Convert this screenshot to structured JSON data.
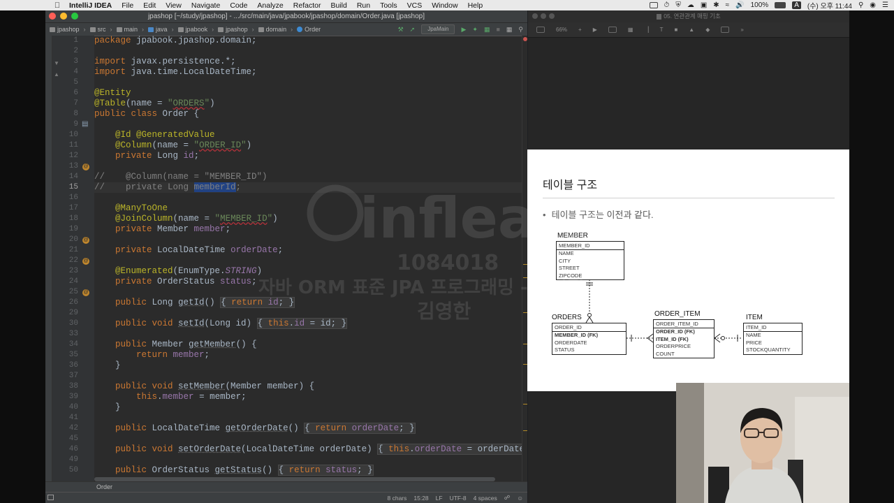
{
  "menubar": {
    "app": "IntelliJ IDEA",
    "items": [
      "File",
      "Edit",
      "View",
      "Navigate",
      "Code",
      "Analyze",
      "Refactor",
      "Build",
      "Run",
      "Tools",
      "VCS",
      "Window",
      "Help"
    ],
    "battery": "100%",
    "input_source": "A",
    "clock": "(수) 오후 11:44"
  },
  "ide": {
    "title": "jpashop [~/study/jpashop] - .../src/main/java/jpabook/jpashop/domain/Order.java [jpashop]",
    "breadcrumbs": [
      "jpashop",
      "src",
      "main",
      "java",
      "jpabook",
      "jpashop",
      "domain",
      "Order"
    ],
    "run_config": "JpaMain",
    "line_numbers": [
      "1",
      "2",
      "3",
      "4",
      "5",
      "6",
      "7",
      "8",
      "9",
      "10",
      "11",
      "12",
      "13",
      "14",
      "15",
      "16",
      "17",
      "18",
      "19",
      "20",
      "21",
      "22",
      "23",
      "24",
      "25",
      "26",
      "29",
      "30",
      "33",
      "34",
      "35",
      "36",
      "37",
      "38",
      "39",
      "40",
      "41",
      "42",
      "45",
      "46",
      "49",
      "50"
    ],
    "current_line": "15",
    "file_tab": "Order",
    "status": {
      "selection": "8 chars",
      "position": "15:28",
      "line_sep": "LF",
      "encoding": "UTF-8",
      "indent": "4 spaces"
    }
  },
  "keynote": {
    "window_title": "05. 연관관계 매핑 기초",
    "zoom": "66%"
  },
  "slide": {
    "title": "테이블 구조",
    "bullet": "테이블 구조는 이전과 같다.",
    "tables": [
      {
        "name": "MEMBER",
        "pk": "MEMBER_ID",
        "cols": [
          "NAME",
          "CITY",
          "STREET",
          "ZIPCODE"
        ],
        "bold": []
      },
      {
        "name": "ORDERS",
        "pk": "ORDER_ID",
        "cols": [
          "MEMBER_ID (FK)",
          "ORDERDATE",
          "STATUS"
        ],
        "bold": [
          "MEMBER_ID (FK)"
        ]
      },
      {
        "name": "ORDER_ITEM",
        "pk": "ORDER_ITEM_ID",
        "cols": [
          "ORDER_ID (FK)",
          "ITEM_ID (FK)",
          "ORDERPRICE",
          "COUNT"
        ],
        "bold": [
          "ORDER_ID (FK)",
          "ITEM_ID (FK)"
        ]
      },
      {
        "name": "ITEM",
        "pk": "ITEM_ID",
        "cols": [
          "NAME",
          "PRICE",
          "STOCKQUANTITY"
        ],
        "bold": []
      }
    ]
  },
  "watermark": {
    "brand": "inflearn",
    "id": "1084018",
    "course": "자바 ORM 표준 JPA 프로그래밍 - 기본편",
    "author": "김영한"
  },
  "colors": {
    "keyword": "#cc7832",
    "annotation": "#bbb529",
    "string": "#6a8759",
    "field": "#9876aa",
    "comment": "#808080",
    "selection": "#214283"
  }
}
